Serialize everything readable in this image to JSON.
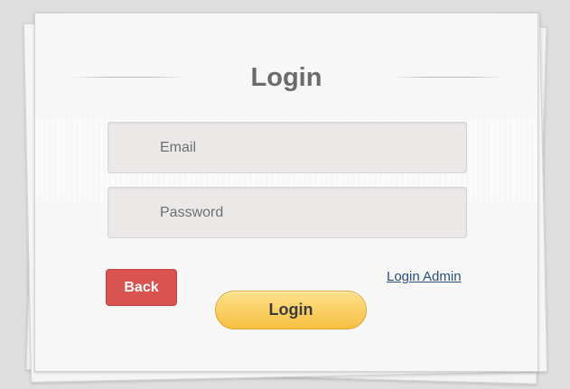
{
  "form": {
    "title": "Login",
    "email_placeholder": "Email",
    "password_placeholder": "Password",
    "back_label": "Back",
    "admin_link_label": "Login Admin",
    "login_label": "Login"
  },
  "colors": {
    "back_button": "#d9534f",
    "login_button": "#f7c043",
    "link": "#2a4f7a",
    "title": "#6b6b6b"
  }
}
